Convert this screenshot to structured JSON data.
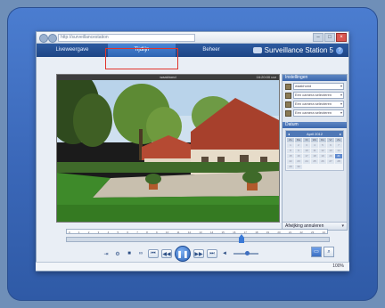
{
  "browser": {
    "address": "http://surveillancestation",
    "window_controls": [
      "–",
      "□",
      "×"
    ]
  },
  "tabs": [
    {
      "label": "Liveweergave",
      "active": false
    },
    {
      "label": "Tijdlijn",
      "active": true
    },
    {
      "label": "Beheer",
      "active": false
    }
  ],
  "app": {
    "title": "Surveillance Station 5",
    "help_label": "?"
  },
  "video": {
    "camera_name": "waakhond",
    "timestamp": "16:20:00 uur"
  },
  "settings": {
    "header": "Instellingen",
    "cameras": [
      "waakhond",
      "Een camera selecteren",
      "Een camera selecteren",
      "Een camera selecteren"
    ]
  },
  "date": {
    "header": "Datum",
    "month_label": "April 2012",
    "day_headers": [
      "Zo",
      "Ma",
      "Di",
      "Wo",
      "Do",
      "Vr",
      "Za"
    ],
    "days": [
      "1",
      "2",
      "3",
      "4",
      "5",
      "6",
      "7",
      "8",
      "9",
      "10",
      "11",
      "12",
      "13",
      "14",
      "15",
      "16",
      "17",
      "18",
      "19",
      "20",
      "21",
      "22",
      "23",
      "24",
      "25",
      "26",
      "27",
      "28",
      "29",
      "30"
    ],
    "selected_day": "21"
  },
  "events": {
    "label": "Afwijking annuleren"
  },
  "timeline": {
    "hours": [
      "0",
      "1",
      "2",
      "3",
      "4",
      "5",
      "6",
      "7",
      "8",
      "9",
      "10",
      "11",
      "12",
      "13",
      "14",
      "15",
      "16",
      "17",
      "18",
      "19",
      "20",
      "21",
      "22",
      "23",
      "24"
    ],
    "position_fraction": 0.67
  },
  "playback": {
    "volume_fraction": 0.55
  },
  "status": {
    "zoom": "100%"
  },
  "colors": {
    "accent": "#2c62b6",
    "highlight": "#e0342c"
  }
}
